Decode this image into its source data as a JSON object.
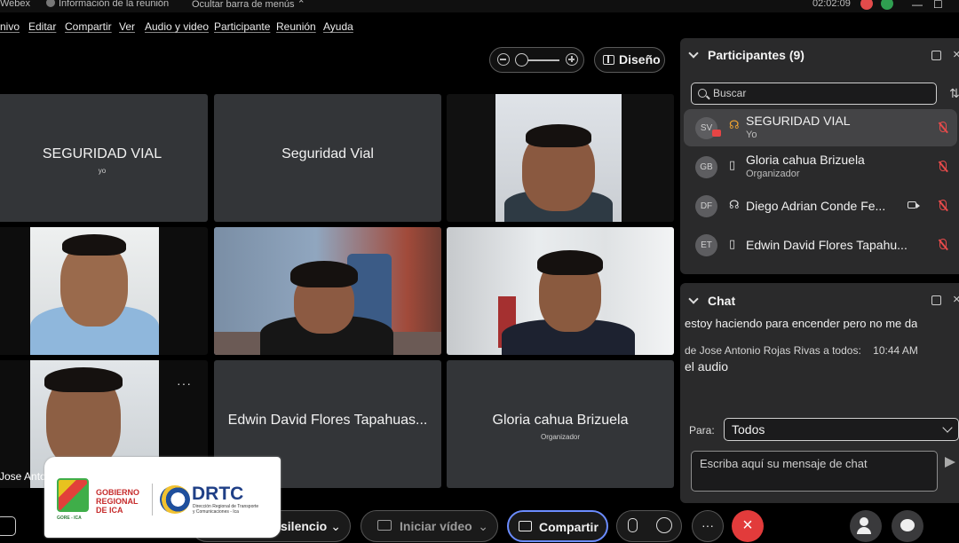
{
  "titlebar": {
    "app": "Webex",
    "meeting_info": "Información de la reunión",
    "hide_menu": "Ocultar barra de menús",
    "clock": "02:02:09"
  },
  "menu": [
    "nivo",
    "Editar",
    "Compartir",
    "Ver",
    "Audio y video",
    "Participante",
    "Reunión",
    "Ayuda"
  ],
  "toolbar": {
    "layout_label": "Diseño"
  },
  "tiles": {
    "t1_name": "SEGURIDAD VIAL",
    "t1_sub": "yo",
    "t2_name": "Seguridad Vial",
    "t7_label": "Jose Anto",
    "t8_name": "Edwin David Flores Tapahuas...",
    "t9_name": "Gloria cahua Brizuela",
    "t9_sub": "Organizador",
    "more": "···"
  },
  "participants": {
    "title": "Participantes (9)",
    "search_placeholder": "Buscar",
    "items": [
      {
        "initials": "SV",
        "name": "SEGURIDAD VIAL",
        "role": "Yo"
      },
      {
        "initials": "GB",
        "name": "Gloria cahua Brizuela",
        "role": "Organizador"
      },
      {
        "initials": "DF",
        "name": "Diego Adrian Conde Fe...",
        "role": ""
      },
      {
        "initials": "ET",
        "name": "Edwin David Flores Tapahu...",
        "role": ""
      }
    ]
  },
  "chat": {
    "title": "Chat",
    "cut_message": "estoy haciendo para encender pero no me da",
    "sender_line": "de Jose Antonio Rojas Rivas a todos:",
    "time": "10:44 AM",
    "message": "el audio",
    "to_label": "Para:",
    "to_value": "Todos",
    "input_placeholder": "Escriba aquí su mensaje de chat"
  },
  "controls": {
    "mute_label": "silencio",
    "video_label": "Iniciar vídeo",
    "share_label": "Compartir",
    "more": "···"
  },
  "logo": {
    "gov_line1": "GOBIERNO",
    "gov_line2": "REGIONAL",
    "gov_line3": "DE ICA",
    "gov_small": "GORE - ICA",
    "drtc": "DRTC",
    "drtc_sub1": "Dirección Regional de Transporte",
    "drtc_sub2": "y Comunicaciones - Ica"
  },
  "colors": {
    "accent_red": "#e23b3b",
    "share_border": "#6b8cff",
    "tile_bg": "#333538",
    "panel_bg": "#2a2a2b"
  }
}
